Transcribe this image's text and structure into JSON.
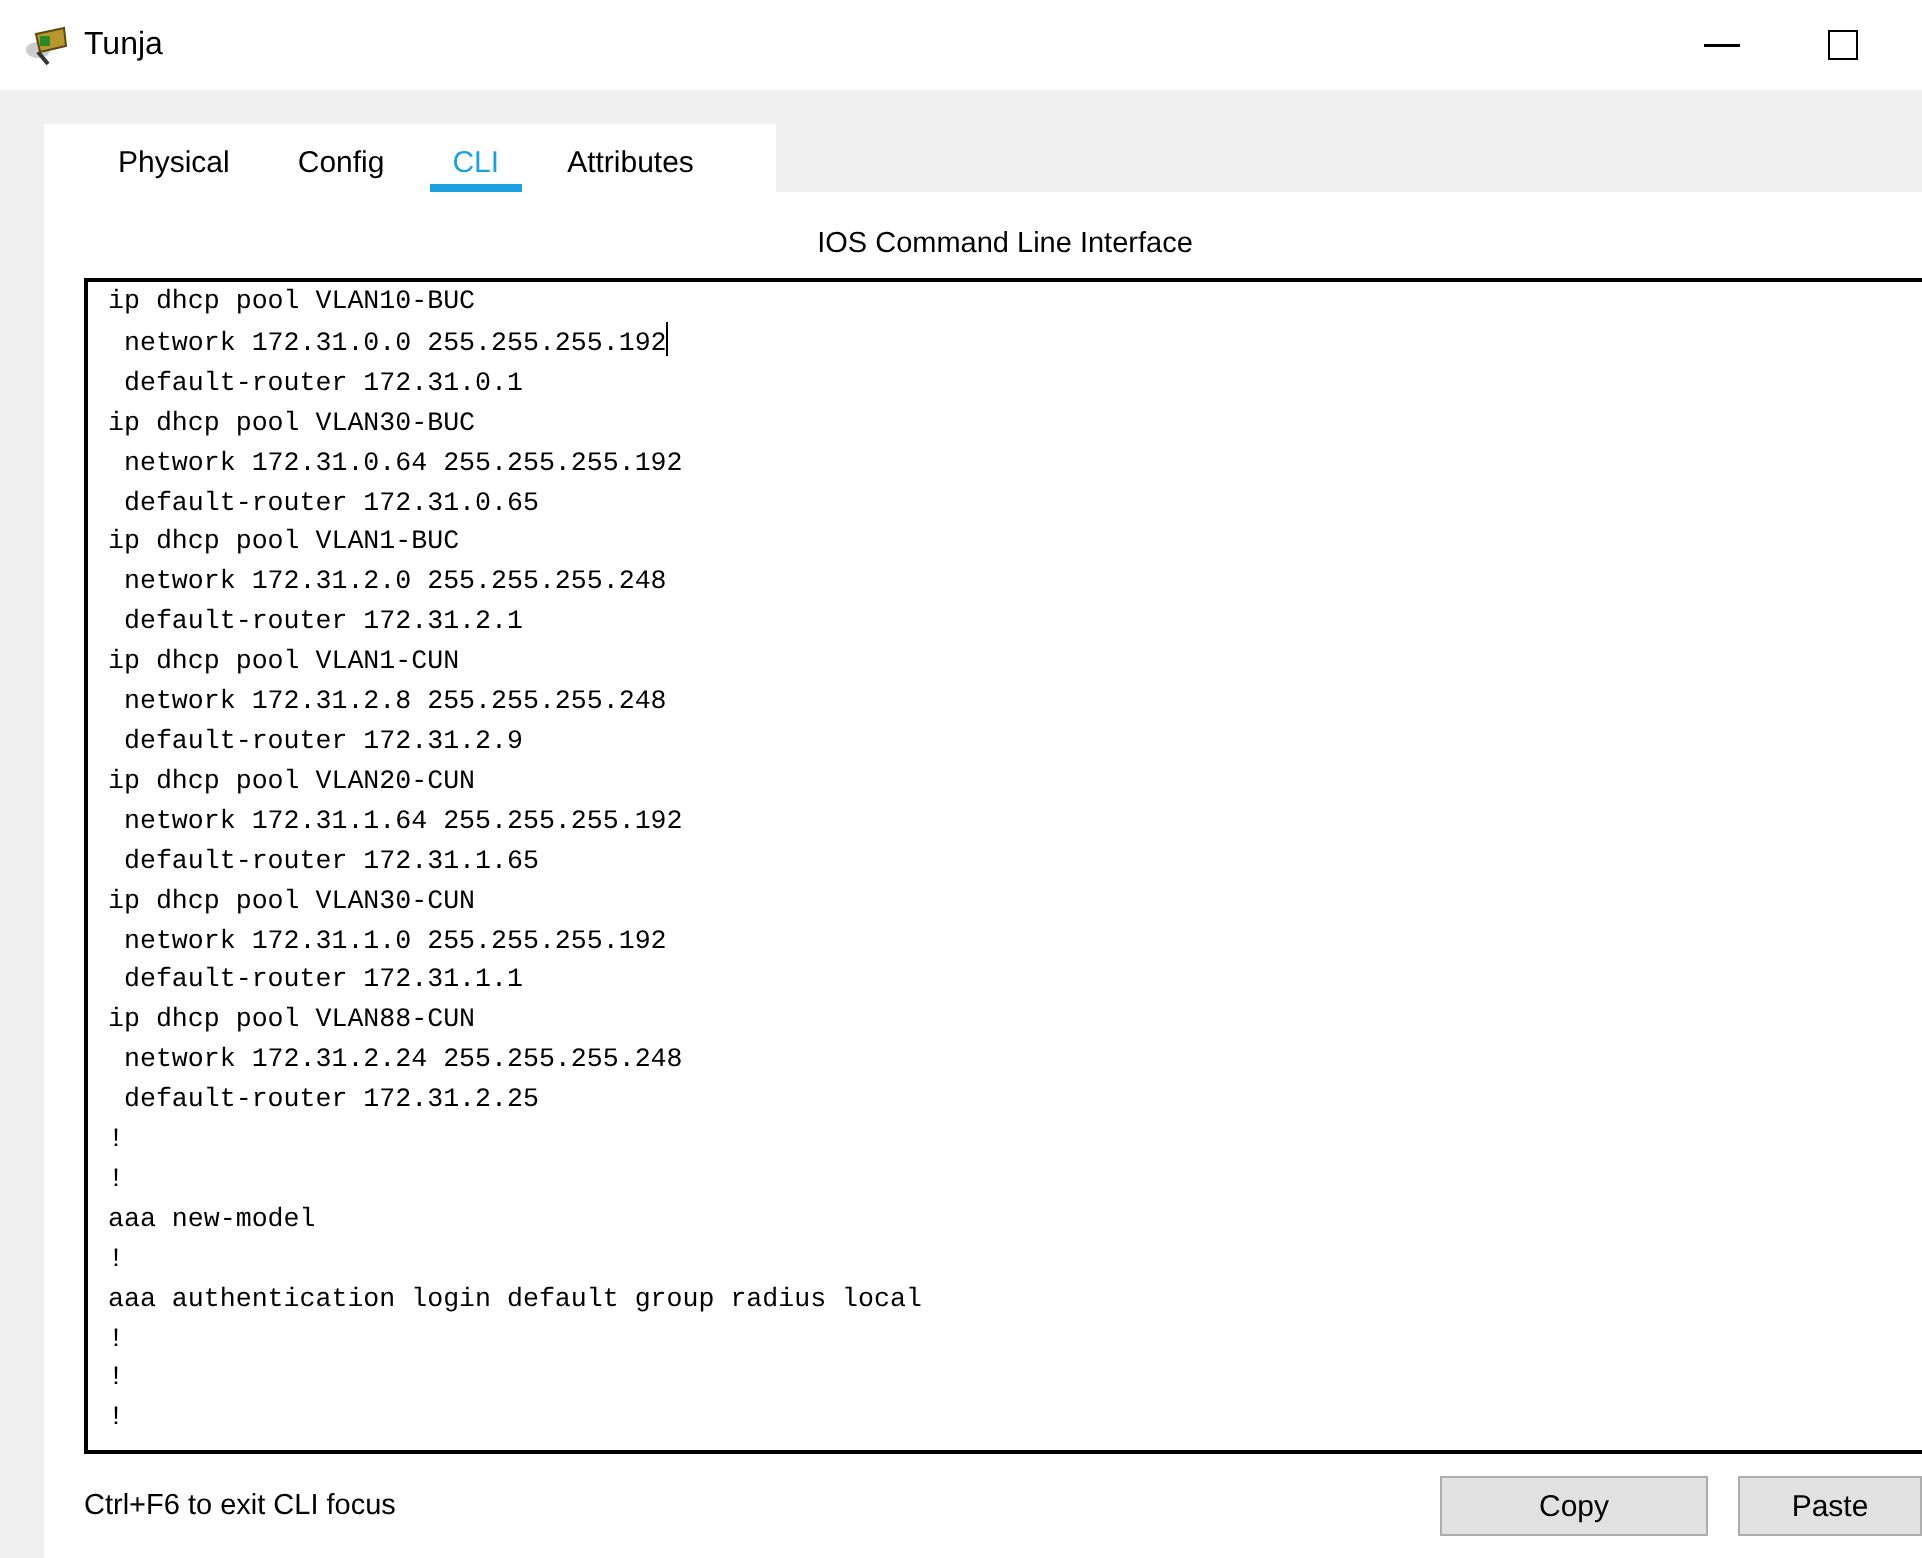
{
  "window": {
    "title": "Tunja"
  },
  "tabs": [
    {
      "label": "Physical",
      "selected": false
    },
    {
      "label": "Config",
      "selected": false
    },
    {
      "label": "CLI",
      "selected": true
    },
    {
      "label": "Attributes",
      "selected": false
    }
  ],
  "heading": "IOS Command Line Interface",
  "console": {
    "lines": [
      {
        "text": "ip dhcp pool VLAN10-BUC",
        "cursor": false
      },
      {
        "text": " network 172.31.0.0 255.255.255.192",
        "cursor": true
      },
      {
        "text": " default-router 172.31.0.1",
        "cursor": false
      },
      {
        "text": "ip dhcp pool VLAN30-BUC",
        "cursor": false
      },
      {
        "text": " network 172.31.0.64 255.255.255.192",
        "cursor": false
      },
      {
        "text": " default-router 172.31.0.65",
        "cursor": false
      },
      {
        "text": "ip dhcp pool VLAN1-BUC",
        "cursor": false
      },
      {
        "text": " network 172.31.2.0 255.255.255.248",
        "cursor": false
      },
      {
        "text": " default-router 172.31.2.1",
        "cursor": false
      },
      {
        "text": "ip dhcp pool VLAN1-CUN",
        "cursor": false
      },
      {
        "text": " network 172.31.2.8 255.255.255.248",
        "cursor": false
      },
      {
        "text": " default-router 172.31.2.9",
        "cursor": false
      },
      {
        "text": "ip dhcp pool VLAN20-CUN",
        "cursor": false
      },
      {
        "text": " network 172.31.1.64 255.255.255.192",
        "cursor": false
      },
      {
        "text": " default-router 172.31.1.65",
        "cursor": false
      },
      {
        "text": "ip dhcp pool VLAN30-CUN",
        "cursor": false
      },
      {
        "text": " network 172.31.1.0 255.255.255.192",
        "cursor": false
      },
      {
        "text": " default-router 172.31.1.1",
        "cursor": false
      },
      {
        "text": "ip dhcp pool VLAN88-CUN",
        "cursor": false
      },
      {
        "text": " network 172.31.2.24 255.255.255.248",
        "cursor": false
      },
      {
        "text": " default-router 172.31.2.25",
        "cursor": false
      },
      {
        "text": "!",
        "cursor": false
      },
      {
        "text": "!",
        "cursor": false
      },
      {
        "text": "aaa new-model",
        "cursor": false
      },
      {
        "text": "!",
        "cursor": false
      },
      {
        "text": "aaa authentication login default group radius local",
        "cursor": false
      },
      {
        "text": "!",
        "cursor": false
      },
      {
        "text": "!",
        "cursor": false
      },
      {
        "text": "!",
        "cursor": false
      }
    ]
  },
  "hint": "Ctrl+F6 to exit CLI focus",
  "buttons": [
    "Copy",
    "Paste"
  ]
}
